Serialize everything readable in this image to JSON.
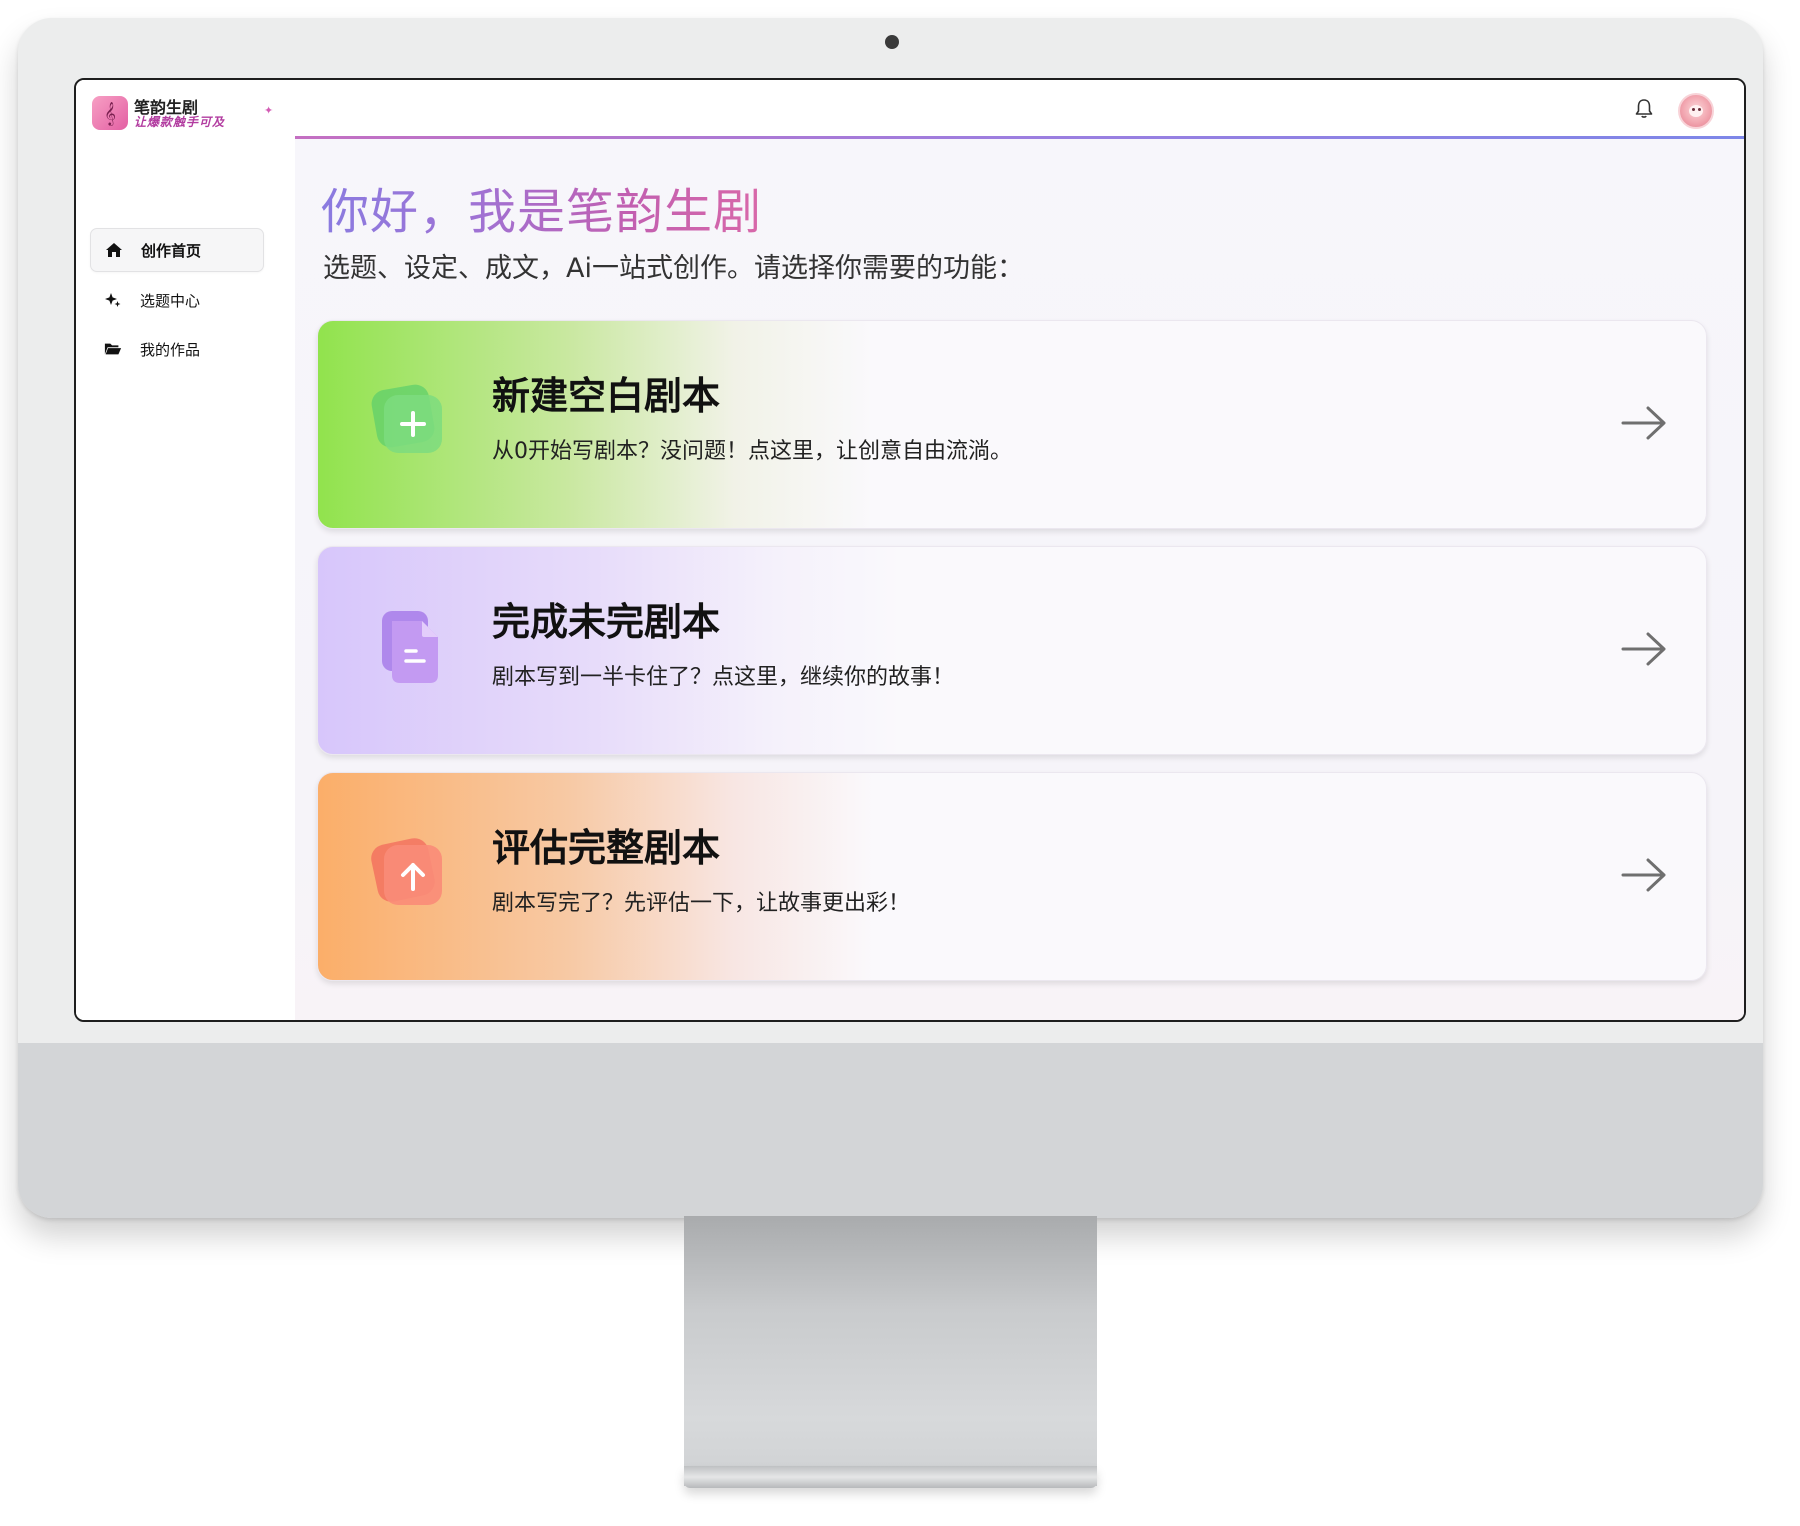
{
  "app": {
    "name": "笔韵生剧",
    "slogan": "让爆款触手可及"
  },
  "sidebar": {
    "items": [
      {
        "label": "创作首页",
        "icon": "home-icon",
        "active": true
      },
      {
        "label": "选题中心",
        "icon": "sparkles-icon",
        "active": false
      },
      {
        "label": "我的作品",
        "icon": "folder-open-icon",
        "active": false
      }
    ]
  },
  "header": {
    "icons": [
      "bell-icon",
      "avatar"
    ]
  },
  "main": {
    "greeting": "你好，我是笔韵生剧",
    "subtitle": "选题、设定、成文，Ai一站式创作。请选择你需要的功能：",
    "cards": [
      {
        "title": "新建空白剧本",
        "description": "从0开始写剧本？没问题！点这里，让创意自由流淌。",
        "icon": "plus-icon",
        "accent": "#8ee04a"
      },
      {
        "title": "完成未完剧本",
        "description": "剧本写到一半卡住了？点这里，继续你的故事！",
        "icon": "document-icon",
        "accent": "#c7a9f5"
      },
      {
        "title": "评估完整剧本",
        "description": "剧本写完了？先评估一下，让故事更出彩！",
        "icon": "upload-icon",
        "accent": "#f9ae6a"
      }
    ]
  },
  "colors": {
    "greeting_gradient_start": "#8a7be0",
    "greeting_gradient_end": "#d868a9",
    "topbar_underline": "#a97ad8"
  }
}
